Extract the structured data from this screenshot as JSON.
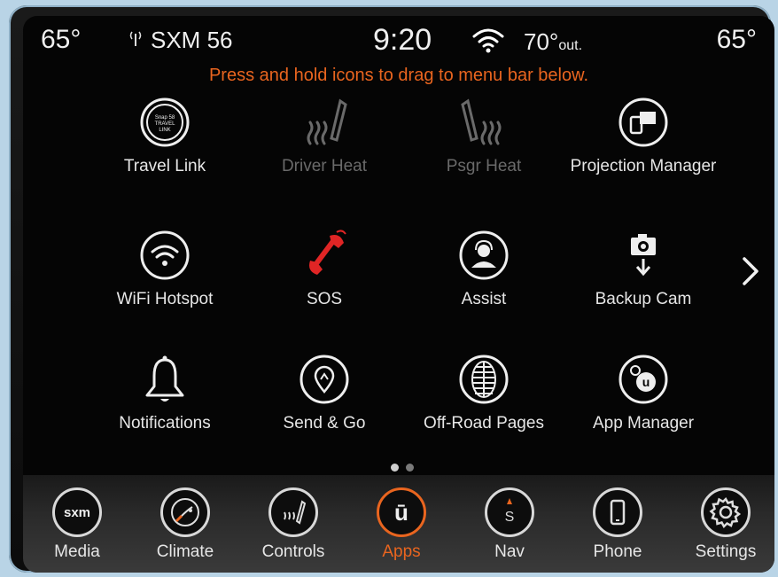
{
  "status": {
    "temp_left": "65°",
    "temp_right": "65°",
    "radio": "SXM 56",
    "time": "9:20",
    "outside_temp": "70°",
    "outside_unit": "out."
  },
  "hint": "Press and hold icons to drag to menu bar below.",
  "apps": [
    {
      "label": "Travel Link",
      "icon": "travel-link-icon",
      "icon_text": "Snap 58 TRAVEL LINK"
    },
    {
      "label": "Driver Heat",
      "icon": "driver-seat-heat-icon"
    },
    {
      "label": "Psgr Heat",
      "icon": "passenger-seat-heat-icon"
    },
    {
      "label": "Projection Manager",
      "icon": "projection-manager-icon"
    },
    {
      "label": "WiFi Hotspot",
      "icon": "wifi-hotspot-icon"
    },
    {
      "label": "SOS",
      "icon": "sos-phone-icon"
    },
    {
      "label": "Assist",
      "icon": "assist-icon"
    },
    {
      "label": "Backup Cam",
      "icon": "backup-camera-icon"
    },
    {
      "label": "Notifications",
      "icon": "bell-icon"
    },
    {
      "label": "Send & Go",
      "icon": "send-and-go-icon"
    },
    {
      "label": "Off-Road Pages",
      "icon": "off-road-tire-icon"
    },
    {
      "label": "App Manager",
      "icon": "app-manager-icon"
    }
  ],
  "menubar": [
    {
      "label": "Media",
      "icon": "sxm-icon",
      "icon_text": "sxm"
    },
    {
      "label": "Climate",
      "icon": "climate-icon"
    },
    {
      "label": "Controls",
      "icon": "controls-icon"
    },
    {
      "label": "Apps",
      "icon": "apps-icon",
      "icon_text": "ū"
    },
    {
      "label": "Nav",
      "icon": "nav-compass-icon",
      "icon_text": "S"
    },
    {
      "label": "Phone",
      "icon": "phone-icon"
    },
    {
      "label": "Settings",
      "icon": "gear-icon"
    }
  ],
  "colors": {
    "accent": "#e9651f",
    "sos_red": "#e02525",
    "text": "#e6e6e6",
    "dimmed": "#6a6a6a"
  }
}
